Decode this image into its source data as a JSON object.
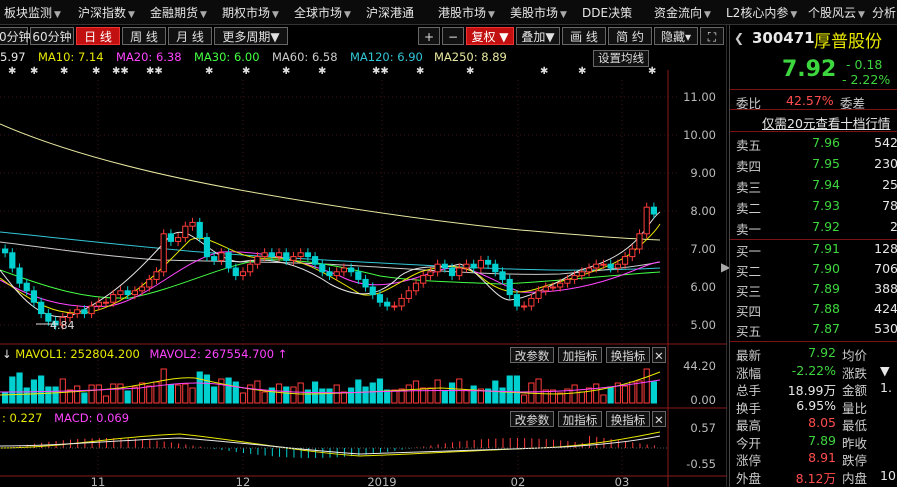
{
  "menu": {
    "items": [
      "板块监测",
      "沪深指数",
      "金融期货",
      "期权市场",
      "全球市场",
      "沪深港通",
      "港股市场",
      "美股市场",
      "DDE决策",
      "资金流向",
      "L2核心内参",
      "个股风云",
      "分析"
    ]
  },
  "toolbar": {
    "period_60s": "0分钟",
    "period_60m": "60分钟",
    "day": "日 线",
    "week": "周 线",
    "month": "月 线",
    "more": "更多周期▼",
    "plus": "+",
    "minus": "−",
    "fuquan": "复权 ▼",
    "overlay": "叠加▼",
    "draw": "画 线",
    "simple": "简 约",
    "hide": "隐藏▾",
    "expand": "⛶"
  },
  "ma_line": {
    "ma5": "5.97",
    "ma10": "MA10: 7.14",
    "ma20": "MA20: 6.38",
    "ma30": "MA30: 6.00",
    "ma60": "MA60: 6.58",
    "ma120": "MA120: 6.90",
    "ma250": "MA250: 8.89",
    "settings": "设置均线"
  },
  "colors": {
    "ma5": "#e8e8e8",
    "ma10": "#e8e800",
    "ma20": "#ff44ff",
    "ma30": "#44ff44",
    "ma60": "#cccccc",
    "ma120": "#33c6d6",
    "ma250": "#e8e8a0",
    "up": "#ff3c3c",
    "down": "#00d0d0"
  },
  "price_axis": [
    "11.00",
    "10.00",
    "9.00",
    "8.00",
    "7.00",
    "6.00",
    "5.00"
  ],
  "low_label": "4.84",
  "volume": {
    "mavol1": "MAVOL1: 252804.200",
    "mavol2": "MAVOL2: 267554.700",
    "axis_top": "44.20",
    "axis_bottom": "0.00",
    "btn_params": "改参数",
    "btn_add": "加指标",
    "btn_switch": "换指标"
  },
  "macd": {
    "dea": "0.227",
    "macd": "MACD: 0.069",
    "axis_top": "0.57",
    "axis_bottom": "-0.55",
    "btn_params": "改参数",
    "btn_add": "加指标",
    "btn_switch": "换指标"
  },
  "x_axis": [
    "11",
    "12",
    "2019",
    "02",
    "03"
  ],
  "stock": {
    "code": "300471",
    "name": "厚普股份",
    "price": "7.92",
    "change": "- 0.18",
    "change_pct": "- 2.22%",
    "weibi_label": "委比",
    "weibi": "42.57%",
    "weicha_label": "委差",
    "promo": "仅需20元查看十档行情",
    "asks": [
      {
        "label": "卖五",
        "price": "7.96",
        "vol": "542"
      },
      {
        "label": "卖四",
        "price": "7.95",
        "vol": "230"
      },
      {
        "label": "卖三",
        "price": "7.94",
        "vol": "25"
      },
      {
        "label": "卖二",
        "price": "7.93",
        "vol": "78"
      },
      {
        "label": "卖一",
        "price": "7.92",
        "vol": "2"
      }
    ],
    "bids": [
      {
        "label": "买一",
        "price": "7.91",
        "vol": "128"
      },
      {
        "label": "买二",
        "price": "7.90",
        "vol": "706"
      },
      {
        "label": "买三",
        "price": "7.89",
        "vol": "388"
      },
      {
        "label": "买四",
        "price": "7.88",
        "vol": "424"
      },
      {
        "label": "买五",
        "price": "7.87",
        "vol": "530"
      }
    ],
    "stats": [
      {
        "l1": "最新",
        "v1": "7.92",
        "c1": "green",
        "l2": "均价",
        "v2": ""
      },
      {
        "l1": "涨幅",
        "v1": "-2.22%",
        "c1": "green",
        "l2": "涨跌",
        "v2": "▼"
      },
      {
        "l1": "总手",
        "v1": "18.99万",
        "c1": "white",
        "l2": "金额",
        "v2": "1."
      },
      {
        "l1": "换手",
        "v1": "6.95%",
        "c1": "white",
        "l2": "量比",
        "v2": ""
      },
      {
        "l1": "最高",
        "v1": "8.05",
        "c1": "red",
        "l2": "最低",
        "v2": ""
      },
      {
        "l1": "今开",
        "v1": "7.89",
        "c1": "green",
        "l2": "昨收",
        "v2": ""
      },
      {
        "l1": "涨停",
        "v1": "8.91",
        "c1": "red",
        "l2": "跌停",
        "v2": ""
      },
      {
        "l1": "外盘",
        "v1": "8.12万",
        "c1": "red",
        "l2": "内盘",
        "v2": "10."
      }
    ]
  }
}
